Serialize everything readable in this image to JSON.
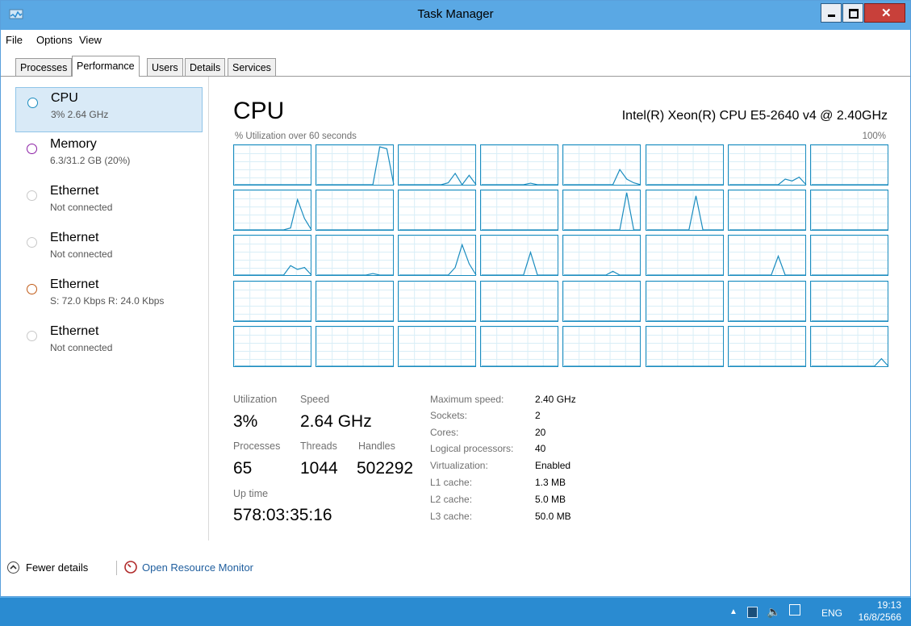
{
  "window": {
    "title": "Task Manager"
  },
  "menu": [
    "File",
    "Options",
    "View"
  ],
  "tabs": [
    "Processes",
    "Performance",
    "Users",
    "Details",
    "Services"
  ],
  "sidebar": [
    {
      "name": "CPU",
      "sub": "3% 2.64 GHz",
      "color": "#1a8cbf"
    },
    {
      "name": "Memory",
      "sub": "6.3/31.2 GB (20%)",
      "color": "#8b1ea4"
    },
    {
      "name": "Ethernet",
      "sub": "Not connected",
      "color": "#a0a0a0"
    },
    {
      "name": "Ethernet",
      "sub": "Not connected",
      "color": "#a0a0a0"
    },
    {
      "name": "Ethernet",
      "sub": "S: 72.0 Kbps R: 24.0 Kbps",
      "color": "#c05a16"
    },
    {
      "name": "Ethernet",
      "sub": "Not connected",
      "color": "#a0a0a0"
    }
  ],
  "main": {
    "title": "CPU",
    "model": "Intel(R) Xeon(R) CPU E5-2640 v4 @ 2.40GHz",
    "util_label": "% Utilization over 60 seconds",
    "util_max": "100%"
  },
  "stats": {
    "utilization_label": "Utilization",
    "utilization": "3%",
    "speed_label": "Speed",
    "speed": "2.64 GHz",
    "processes_label": "Processes",
    "processes": "65",
    "threads_label": "Threads",
    "threads": "1044",
    "handles_label": "Handles",
    "handles": "502292",
    "uptime_label": "Up time",
    "uptime": "578:03:35:16"
  },
  "details": [
    {
      "label": "Maximum speed:",
      "value": "2.40 GHz"
    },
    {
      "label": "Sockets:",
      "value": "2"
    },
    {
      "label": "Cores:",
      "value": "20"
    },
    {
      "label": "Logical processors:",
      "value": "40"
    },
    {
      "label": "Virtualization:",
      "value": "Enabled"
    },
    {
      "label": "L1 cache:",
      "value": "1.3 MB"
    },
    {
      "label": "L2 cache:",
      "value": "5.0 MB"
    },
    {
      "label": "L3 cache:",
      "value": "50.0 MB"
    }
  ],
  "footer": {
    "fewer_details": "Fewer details",
    "open_resource_monitor": "Open Resource Monitor"
  },
  "taskbar": {
    "lang": "ENG",
    "time": "19:13",
    "date": "16/8/2566"
  },
  "colors": {
    "accent": "#1a8cbf",
    "titlebar": "#5aa8e4",
    "taskbar": "#2a8bd1"
  },
  "cpu_graphs": [
    [
      0,
      0,
      0,
      0,
      0
    ],
    [
      0,
      0,
      0,
      0,
      0,
      0,
      0,
      0,
      0,
      1,
      0.95,
      0
    ],
    [
      0,
      0,
      0,
      0,
      0,
      0,
      0,
      0.05,
      0.3,
      0,
      0.25,
      0
    ],
    [
      0,
      0,
      0,
      0,
      0,
      0,
      0,
      0.04,
      0,
      0,
      0,
      0
    ],
    [
      0,
      0,
      0,
      0,
      0,
      0,
      0,
      0,
      0.4,
      0.15,
      0.05,
      0
    ],
    [
      0,
      0,
      0,
      0,
      0,
      0,
      0,
      0,
      0,
      0,
      0,
      0
    ],
    [
      0,
      0,
      0,
      0,
      0,
      0,
      0,
      0,
      0.15,
      0.1,
      0.2,
      0
    ],
    [
      0,
      0,
      0,
      0,
      0,
      0
    ],
    [
      0,
      0,
      0,
      0,
      0,
      0,
      0,
      0,
      0.05,
      0.8,
      0.3,
      0
    ],
    [
      0,
      0,
      0,
      0,
      0,
      0
    ],
    [
      0,
      0,
      0,
      0,
      0,
      0
    ],
    [
      0,
      0,
      0,
      0,
      0,
      0
    ],
    [
      0,
      0,
      0,
      0,
      0,
      0,
      0,
      0,
      0,
      0.98,
      0,
      0
    ],
    [
      0,
      0,
      0,
      0,
      0,
      0,
      0,
      0.9,
      0,
      0,
      0,
      0
    ],
    [
      0,
      0,
      0,
      0,
      0,
      0
    ],
    [
      0,
      0,
      0,
      0,
      0,
      0
    ],
    [
      0,
      0,
      0,
      0,
      0,
      0,
      0,
      0,
      0.25,
      0.15,
      0.2,
      0
    ],
    [
      0,
      0,
      0,
      0,
      0,
      0,
      0,
      0,
      0.04,
      0,
      0,
      0
    ],
    [
      0,
      0,
      0,
      0,
      0,
      0,
      0,
      0,
      0.2,
      0.8,
      0.3,
      0
    ],
    [
      0,
      0,
      0,
      0,
      0,
      0,
      0,
      0.6,
      0,
      0,
      0,
      0
    ],
    [
      0,
      0,
      0,
      0,
      0,
      0,
      0,
      0.1,
      0,
      0,
      0,
      0
    ],
    [
      0,
      0,
      0,
      0,
      0,
      0
    ],
    [
      0,
      0,
      0,
      0,
      0,
      0,
      0,
      0.5,
      0,
      0,
      0,
      0
    ],
    [
      0,
      0,
      0,
      0,
      0,
      0
    ],
    [
      0,
      0,
      0,
      0,
      0,
      0
    ],
    [
      0,
      0,
      0,
      0,
      0,
      0
    ],
    [
      0,
      0,
      0,
      0,
      0,
      0
    ],
    [
      0,
      0,
      0,
      0,
      0,
      0
    ],
    [
      0,
      0,
      0,
      0,
      0,
      0
    ],
    [
      0,
      0,
      0,
      0,
      0,
      0
    ],
    [
      0,
      0,
      0,
      0,
      0,
      0
    ],
    [
      0,
      0,
      0,
      0,
      0,
      0
    ],
    [
      0,
      0,
      0,
      0,
      0,
      0
    ],
    [
      0,
      0,
      0,
      0,
      0,
      0
    ],
    [
      0,
      0,
      0,
      0,
      0,
      0
    ],
    [
      0,
      0,
      0,
      0,
      0,
      0
    ],
    [
      0,
      0,
      0,
      0,
      0,
      0
    ],
    [
      0,
      0,
      0,
      0,
      0,
      0
    ],
    [
      0,
      0,
      0,
      0,
      0,
      0
    ],
    [
      0,
      0,
      0,
      0,
      0,
      0,
      0,
      0,
      0,
      0,
      0.2,
      0
    ]
  ]
}
